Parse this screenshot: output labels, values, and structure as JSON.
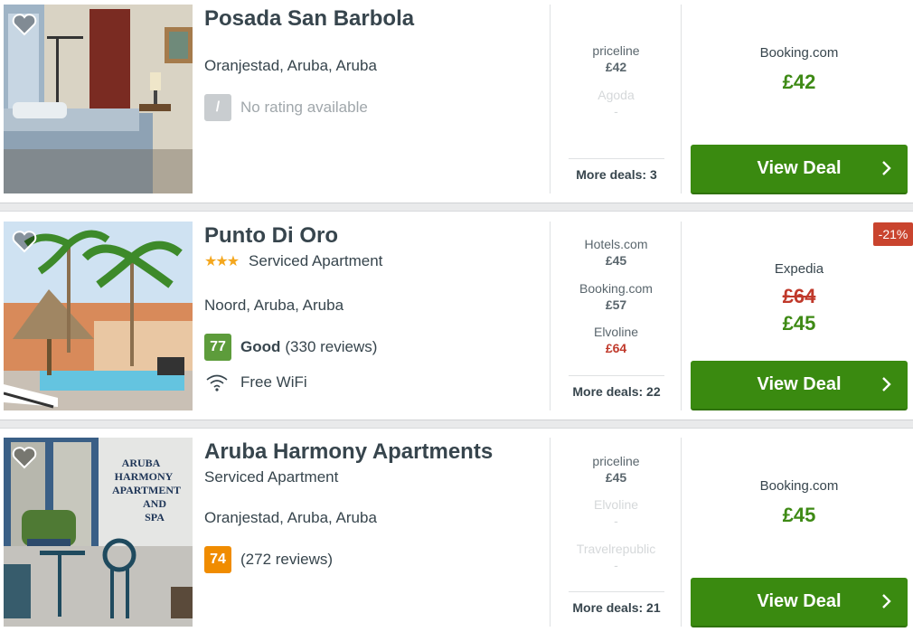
{
  "hotels": [
    {
      "name": "Posada San Barbola",
      "location": "Oranjestad, Aruba, Aruba",
      "rating": {
        "score": "/",
        "text": "No rating available"
      },
      "deals": [
        {
          "provider": "priceline",
          "price": "£42"
        },
        {
          "provider": "Agoda",
          "price": "-"
        }
      ],
      "more_deals": "More deals: 3",
      "best": {
        "provider": "Booking.com",
        "price": "£42"
      },
      "cta": "View Deal"
    },
    {
      "name": "Punto Di Oro",
      "stars": "★★★",
      "type": "Serviced Apartment",
      "location": "Noord, Aruba, Aruba",
      "rating": {
        "score": "77",
        "label": "Good",
        "reviews": "(330 reviews)"
      },
      "amenity": "Free WiFi",
      "deals": [
        {
          "provider": "Hotels.com",
          "price": "£45"
        },
        {
          "provider": "Booking.com",
          "price": "£57"
        },
        {
          "provider": "Elvoline",
          "price": "£64"
        }
      ],
      "more_deals": "More deals: 22",
      "best": {
        "provider": "Expedia",
        "old_price": "£64",
        "price": "£45",
        "discount": "-21%"
      },
      "cta": "View Deal"
    },
    {
      "name": "Aruba Harmony Apartments",
      "type": "Serviced Apartment",
      "location": "Oranjestad, Aruba, Aruba",
      "rating": {
        "score": "74",
        "reviews": "(272 reviews)"
      },
      "deals": [
        {
          "provider": "priceline",
          "price": "£45"
        },
        {
          "provider": "Elvoline",
          "price": "-"
        },
        {
          "provider": "Travelrepublic",
          "price": "-"
        }
      ],
      "more_deals": "More deals: 21",
      "best": {
        "provider": "Booking.com",
        "price": "£45"
      },
      "cta": "View Deal",
      "sign_text": [
        "ARUBA",
        "HARMONY",
        "APARTMENT",
        "AND",
        "SPA"
      ]
    }
  ],
  "colors": {
    "primary_green": "#3a8a10",
    "price_green": "#3e8a15",
    "discount_red": "#c9442e",
    "star_gold": "#f4a71e"
  },
  "icons": {
    "favorite": "heart-outline-icon",
    "wifi": "wifi-icon",
    "cta": "chevron-right-icon"
  }
}
